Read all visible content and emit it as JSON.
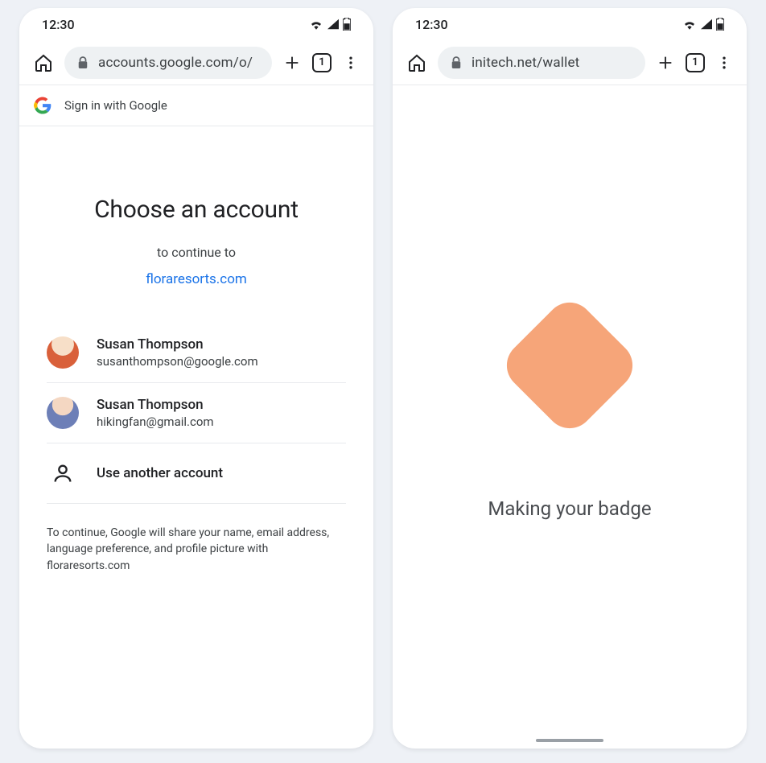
{
  "status": {
    "time": "12:30",
    "tab_count": "1"
  },
  "left": {
    "url": "accounts.google.com/o/",
    "gis_title": "Sign in with Google",
    "heading": "Choose an account",
    "subtitle": "to continue to",
    "target_site": "floraresorts.com",
    "accounts": [
      {
        "name": "Susan Thompson",
        "email": "susanthompson@google.com"
      },
      {
        "name": "Susan Thompson",
        "email": "hikingfan@gmail.com"
      }
    ],
    "use_another": "Use another account",
    "disclaimer": "To continue, Google will share your name, email address, language preference, and profile picture with floraresorts.com"
  },
  "right": {
    "url": "initech.net/wallet",
    "message": "Making your badge"
  }
}
